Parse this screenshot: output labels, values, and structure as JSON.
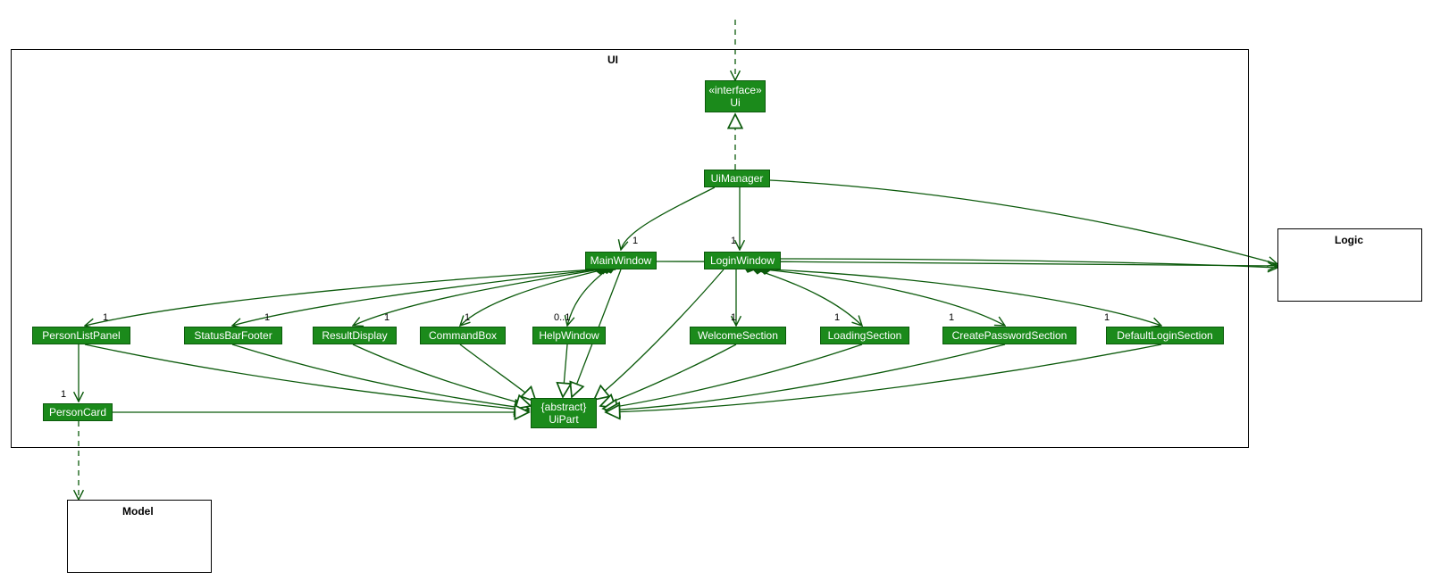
{
  "packages": {
    "ui": {
      "label": "UI"
    },
    "logic": {
      "label": "Logic"
    },
    "model": {
      "label": "Model"
    }
  },
  "nodes": {
    "uiInterface": {
      "stereo": "«interface»",
      "name": "Ui"
    },
    "uiManager": {
      "name": "UiManager"
    },
    "mainWindow": {
      "name": "MainWindow"
    },
    "loginWindow": {
      "name": "LoginWindow"
    },
    "personListPanel": {
      "name": "PersonListPanel"
    },
    "statusBarFooter": {
      "name": "StatusBarFooter"
    },
    "resultDisplay": {
      "name": "ResultDisplay"
    },
    "commandBox": {
      "name": "CommandBox"
    },
    "helpWindow": {
      "name": "HelpWindow"
    },
    "welcomeSection": {
      "name": "WelcomeSection"
    },
    "loadingSection": {
      "name": "LoadingSection"
    },
    "createPasswordSection": {
      "name": "CreatePasswordSection"
    },
    "defaultLoginSection": {
      "name": "DefaultLoginSection"
    },
    "personCard": {
      "name": "PersonCard"
    },
    "uiPart": {
      "stereo": "{abstract}",
      "name": "UiPart"
    }
  },
  "multiplicities": {
    "mainWindow": "1",
    "loginWindow": "1",
    "personListPanel": "1",
    "statusBarFooter": "1",
    "resultDisplay": "1",
    "commandBox": "1",
    "helpWindow": "0..1",
    "welcomeSection": "1",
    "loadingSection": "1",
    "createPasswordSection": "1",
    "defaultLoginSection": "1",
    "personCard": "1"
  },
  "chart_data": {
    "type": "uml-class-diagram",
    "packages": [
      "UI",
      "Logic",
      "Model"
    ],
    "classes_in_UI": [
      "Ui (interface)",
      "UiManager",
      "MainWindow",
      "LoginWindow",
      "PersonListPanel",
      "StatusBarFooter",
      "ResultDisplay",
      "CommandBox",
      "HelpWindow",
      "WelcomeSection",
      "LoadingSection",
      "CreatePasswordSection",
      "DefaultLoginSection",
      "PersonCard",
      "UiPart (abstract)"
    ],
    "relationships": [
      {
        "from": "(external)",
        "to": "Ui",
        "type": "dependency"
      },
      {
        "from": "UiManager",
        "to": "Ui",
        "type": "realization"
      },
      {
        "from": "UiManager",
        "to": "MainWindow",
        "type": "association",
        "multiplicity": "1"
      },
      {
        "from": "UiManager",
        "to": "LoginWindow",
        "type": "association",
        "multiplicity": "1"
      },
      {
        "from": "UiManager",
        "to": "Logic",
        "type": "association"
      },
      {
        "from": "MainWindow",
        "to": "PersonListPanel",
        "type": "composition",
        "multiplicity": "1"
      },
      {
        "from": "MainWindow",
        "to": "StatusBarFooter",
        "type": "composition",
        "multiplicity": "1"
      },
      {
        "from": "MainWindow",
        "to": "ResultDisplay",
        "type": "composition",
        "multiplicity": "1"
      },
      {
        "from": "MainWindow",
        "to": "CommandBox",
        "type": "composition",
        "multiplicity": "1"
      },
      {
        "from": "MainWindow",
        "to": "HelpWindow",
        "type": "composition",
        "multiplicity": "0..1"
      },
      {
        "from": "MainWindow",
        "to": "Logic",
        "type": "association"
      },
      {
        "from": "LoginWindow",
        "to": "WelcomeSection",
        "type": "composition",
        "multiplicity": "1"
      },
      {
        "from": "LoginWindow",
        "to": "LoadingSection",
        "type": "composition",
        "multiplicity": "1"
      },
      {
        "from": "LoginWindow",
        "to": "CreatePasswordSection",
        "type": "composition",
        "multiplicity": "1"
      },
      {
        "from": "LoginWindow",
        "to": "DefaultLoginSection",
        "type": "composition",
        "multiplicity": "1"
      },
      {
        "from": "LoginWindow",
        "to": "Logic",
        "type": "association"
      },
      {
        "from": "PersonListPanel",
        "to": "PersonCard",
        "type": "association",
        "multiplicity": "1"
      },
      {
        "from": "MainWindow",
        "to": "UiPart",
        "type": "generalization"
      },
      {
        "from": "LoginWindow",
        "to": "UiPart",
        "type": "generalization"
      },
      {
        "from": "PersonListPanel",
        "to": "UiPart",
        "type": "generalization"
      },
      {
        "from": "StatusBarFooter",
        "to": "UiPart",
        "type": "generalization"
      },
      {
        "from": "ResultDisplay",
        "to": "UiPart",
        "type": "generalization"
      },
      {
        "from": "CommandBox",
        "to": "UiPart",
        "type": "generalization"
      },
      {
        "from": "HelpWindow",
        "to": "UiPart",
        "type": "generalization"
      },
      {
        "from": "WelcomeSection",
        "to": "UiPart",
        "type": "generalization"
      },
      {
        "from": "LoadingSection",
        "to": "UiPart",
        "type": "generalization"
      },
      {
        "from": "CreatePasswordSection",
        "to": "UiPart",
        "type": "generalization"
      },
      {
        "from": "DefaultLoginSection",
        "to": "UiPart",
        "type": "generalization"
      },
      {
        "from": "PersonCard",
        "to": "UiPart",
        "type": "generalization"
      },
      {
        "from": "PersonCard",
        "to": "Model",
        "type": "dependency"
      }
    ]
  }
}
